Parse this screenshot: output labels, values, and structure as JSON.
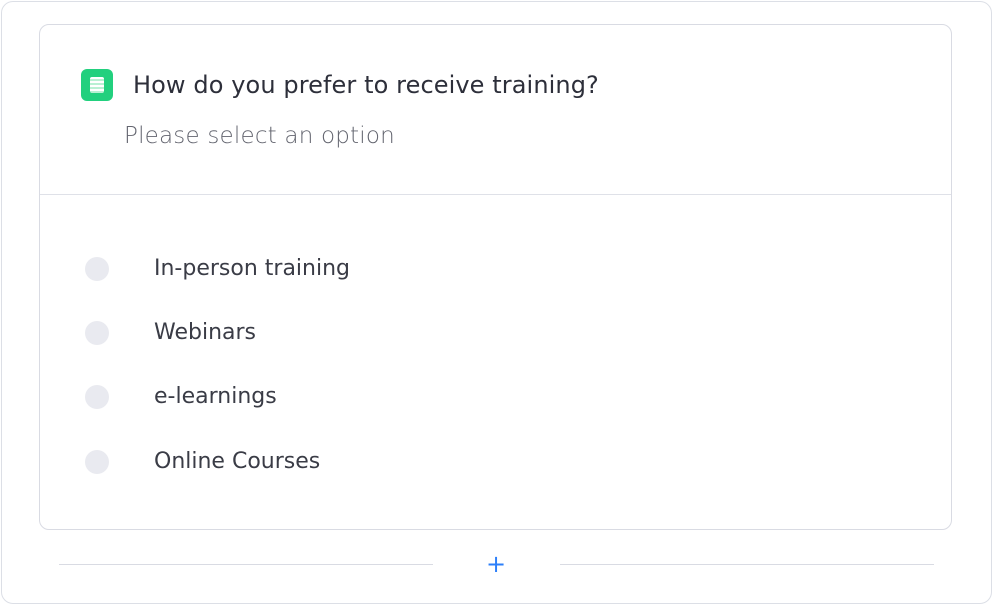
{
  "question": {
    "icon": "form-icon",
    "icon_color": "#22d07e",
    "title": "How do you prefer to receive training?",
    "subtitle": "Please select an option"
  },
  "options": [
    {
      "label": "In-person training"
    },
    {
      "label": "Webinars"
    },
    {
      "label": "e-learnings"
    },
    {
      "label": "Online Courses"
    }
  ],
  "add_button": {
    "icon": "plus-icon",
    "label": "+",
    "color": "#2d7ff9"
  }
}
